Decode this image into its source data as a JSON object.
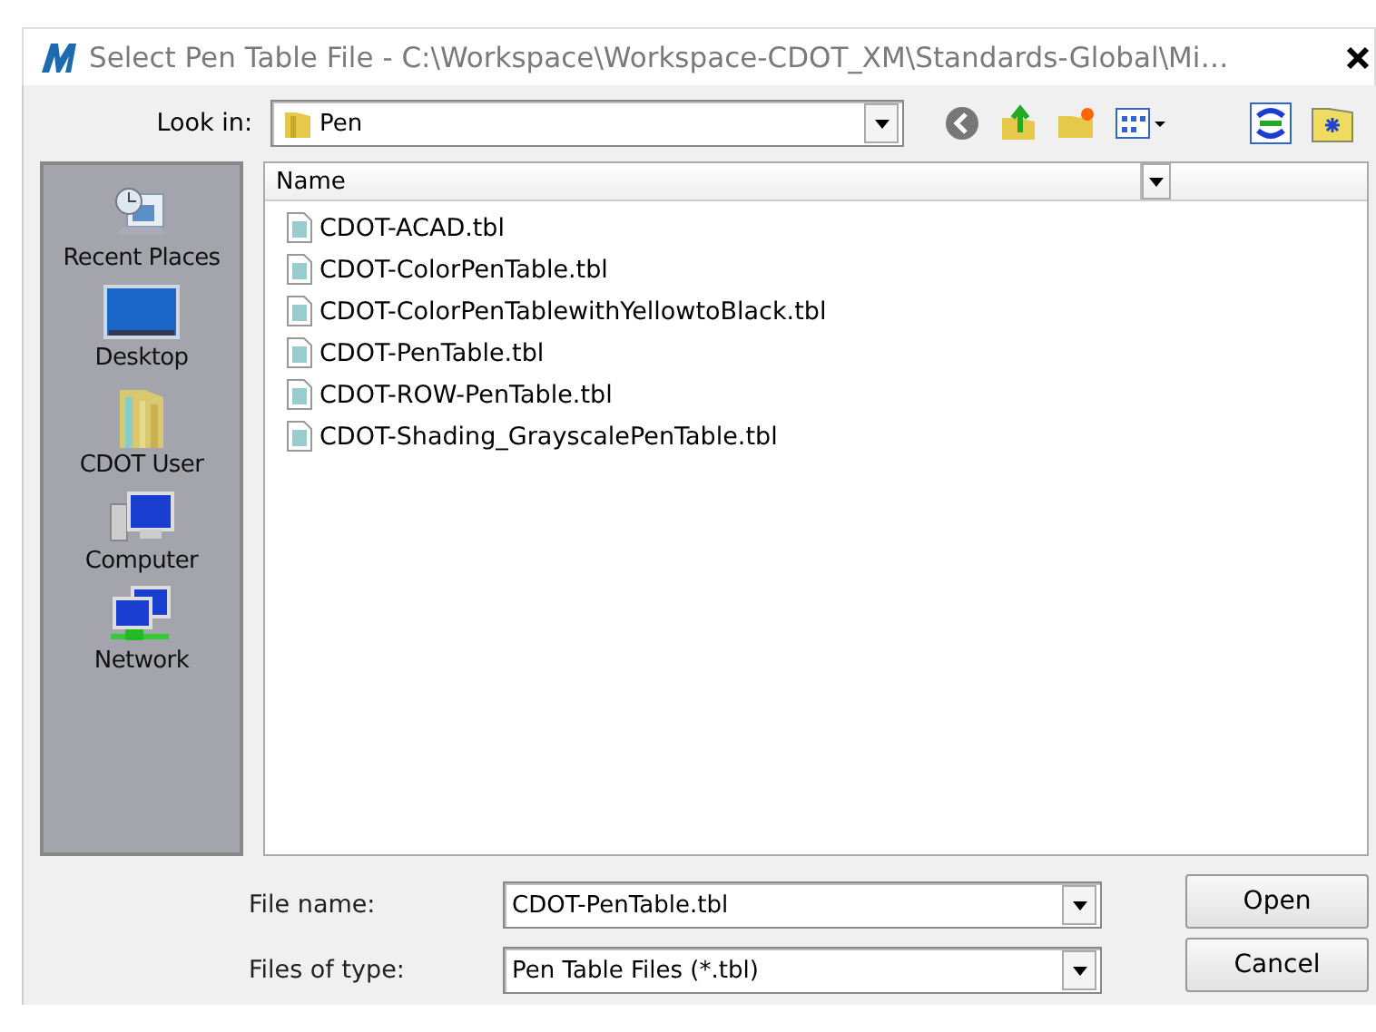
{
  "window": {
    "title": "Select Pen Table File - C:\\Workspace\\Workspace-CDOT_XM\\Standards-Global\\Mi…"
  },
  "look_in": {
    "label": "Look in:",
    "value": "Pen"
  },
  "places": [
    {
      "label": "Recent Places",
      "kind": "recent"
    },
    {
      "label": "Desktop",
      "kind": "desktop"
    },
    {
      "label": "CDOT User",
      "kind": "user"
    },
    {
      "label": "Computer",
      "kind": "computer"
    },
    {
      "label": "Network",
      "kind": "network"
    }
  ],
  "file_list": {
    "columns": [
      "Name"
    ],
    "files": [
      "CDOT-ACAD.tbl",
      "CDOT-ColorPenTable.tbl",
      "CDOT-ColorPenTablewithYellowtoBlack.tbl",
      "CDOT-PenTable.tbl",
      "CDOT-ROW-PenTable.tbl",
      "CDOT-Shading_GrayscalePenTable.tbl"
    ]
  },
  "file_name": {
    "label": "File name:",
    "value": "CDOT-PenTable.tbl"
  },
  "file_type": {
    "label": "Files of type:",
    "value": "Pen Table Files (*.tbl)"
  },
  "buttons": [
    "Open",
    "Cancel"
  ]
}
